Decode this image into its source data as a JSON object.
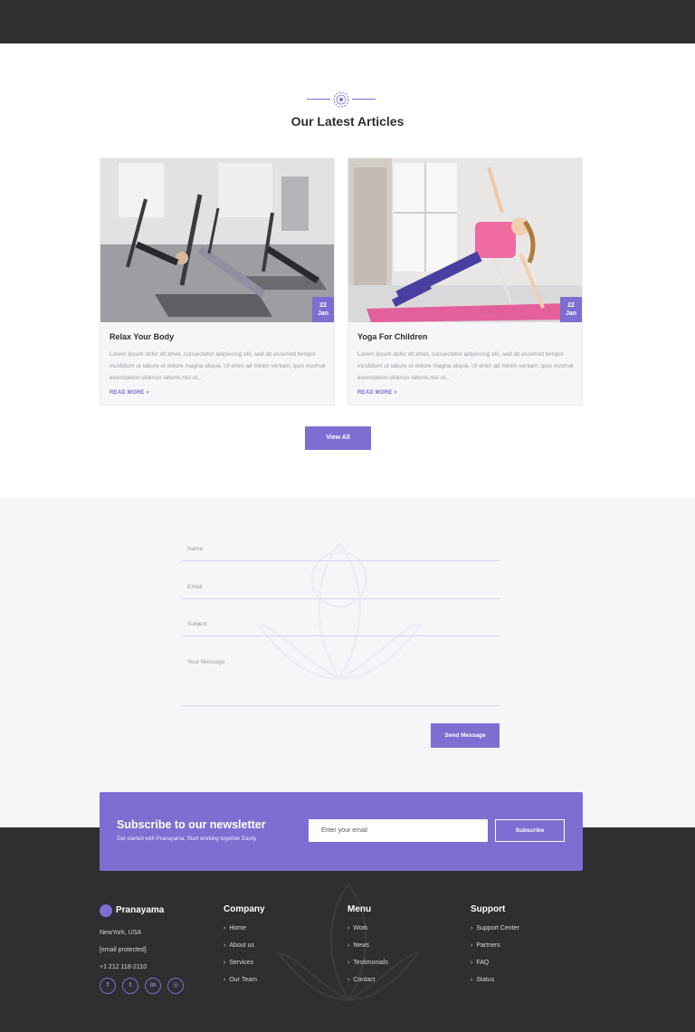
{
  "articles": {
    "title": "Our Latest Articles",
    "cards": [
      {
        "title": "Relax Your Body",
        "date_day": "22",
        "date_month": "Jan",
        "excerpt": "Lorem ipsum dolor sit amet, consectetur adipiscing elit, sed do eiusmod tempor incididunt ut labore et dolore magna aliqua. Ut enim ad minim veniam, quis nostrud exercitation ullamco laboris nisi ut...",
        "read_more": "READ MORE »"
      },
      {
        "title": "Yoga For Children",
        "date_day": "22",
        "date_month": "Jan",
        "excerpt": "Lorem ipsum dolor sit amet, consectetur adipiscing elit, sed do eiusmod tempor incididunt ut labore et dolore magna aliqua. Ut enim ad minim veniam, quis nostrud exercitation ullamco laboris nisi ut...",
        "read_more": "READ MORE »"
      }
    ],
    "view_all_label": "View All"
  },
  "contact_form": {
    "name_placeholder": "Name",
    "email_placeholder": "Email",
    "subject_placeholder": "Subject",
    "message_placeholder": "Your Message",
    "send_label": "Send Message"
  },
  "newsletter": {
    "title": "Subscribe to our newsletter",
    "subtitle": "Get started with Pranayama, Start working together Easily",
    "input_placeholder": "Enter your email",
    "subscribe_label": "Subscribe"
  },
  "footer": {
    "brand_name": "Pranayama",
    "location": "NewYork, USA",
    "email": "[email protected]",
    "phone": "+1 212 118-2110",
    "socials": [
      {
        "icon": "facebook-icon",
        "glyph": "f"
      },
      {
        "icon": "twitter-icon",
        "glyph": "t"
      },
      {
        "icon": "linkedin-icon",
        "glyph": "in"
      },
      {
        "icon": "dribbble-icon",
        "glyph": "◎"
      }
    ],
    "company": {
      "title": "Company",
      "links": [
        "Home",
        "About us",
        "Services",
        "Our Team"
      ]
    },
    "menu": {
      "title": "Menu",
      "links": [
        "Work",
        "News",
        "Testimonials",
        "Contact"
      ]
    },
    "support": {
      "title": "Support",
      "links": [
        "Support Center",
        "Partners",
        "FAQ",
        "Status"
      ]
    }
  },
  "colors": {
    "accent": "#7c6fd1",
    "dark": "#2f2e30",
    "light_bg": "#f6f6f8"
  }
}
